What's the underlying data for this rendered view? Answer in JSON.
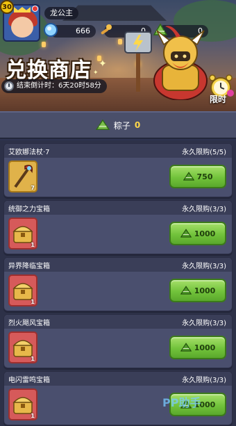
{
  "player": {
    "level": "30",
    "name": "龙公主"
  },
  "resources": [
    {
      "icon": "gem-icon",
      "value": "666"
    },
    {
      "icon": "torch-icon",
      "value": "0"
    },
    {
      "icon": "zongzi-icon",
      "value": "0"
    }
  ],
  "shop": {
    "title": "兑换商店",
    "countdown": "结束倒计时：6天20时58分",
    "limited_label": "限时"
  },
  "currency": {
    "label": "粽子",
    "count": "0"
  },
  "items": [
    {
      "name": "艾欧娜法杖·7",
      "limit": "永久限购(5/5)",
      "qty": "7",
      "price": "750",
      "slot": "gold",
      "icon": "staff-icon"
    },
    {
      "name": "统御之力宝箱",
      "limit": "永久限购(3/3)",
      "qty": "1",
      "price": "1000",
      "slot": "red",
      "icon": "chest-icon"
    },
    {
      "name": "异界降临宝箱",
      "limit": "永久限购(3/3)",
      "qty": "1",
      "price": "1000",
      "slot": "red",
      "icon": "chest-icon"
    },
    {
      "name": "烈火飓风宝箱",
      "limit": "永久限购(3/3)",
      "qty": "1",
      "price": "1000",
      "slot": "red",
      "icon": "chest-icon"
    },
    {
      "name": "电闪雷鸣宝箱",
      "limit": "永久限购(3/3)",
      "qty": "1",
      "price": "1000",
      "slot": "red",
      "icon": "chest-icon"
    }
  ],
  "watermark": "PP助手",
  "colors": {
    "buy_green": "#72c33b",
    "panel": "#4a4f6e",
    "gold_text": "#ffd84a"
  }
}
